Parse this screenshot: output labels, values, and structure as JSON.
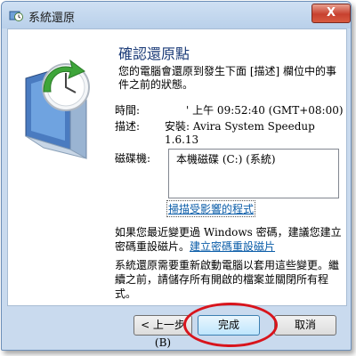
{
  "window": {
    "title": "系統還原",
    "close_label": "X"
  },
  "main": {
    "heading": "確認還原點",
    "intro": "您的電腦會還原到發生下面 [描述] 欄位中的事件之前的狀態。",
    "time_label": "時間:",
    "time_value": "' 上午 09:52:40 (GMT+08:00)",
    "desc_label": "描述:",
    "desc_value": "安裝: Avira System Speedup 1.6.13",
    "drives_label": "磁碟機:",
    "drives": [
      "本機磁碟 (C:) (系統)"
    ],
    "scan_link": "掃描受影響的程式",
    "password_text": "如果您最近變更過 Windows 密碼，建議您建立密碼重設磁片。",
    "password_link": "建立密碼重設磁片",
    "restart_text": "系統還原需要重新啟動電腦以套用這些變更。繼續之前，請儲存所有開啟的檔案並關閉所有程式。"
  },
  "buttons": {
    "back": "< 上一步(B)",
    "finish": "完成",
    "cancel": "取消"
  },
  "colors": {
    "heading": "#1b3b78",
    "link": "#0a5ca8",
    "annotation": "#d8141c"
  }
}
